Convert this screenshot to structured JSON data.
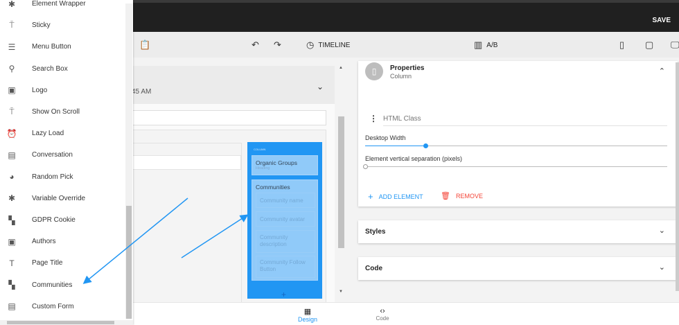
{
  "topbar": {
    "save_label": "SAVE"
  },
  "toolbar": {
    "timeline_label": "TIMELINE",
    "ab_label": "A/B"
  },
  "canvas": {
    "time_text": "45 AM",
    "column_label": "COLUMN",
    "heading_card": {
      "title": "Organic Groups",
      "subtitle": "Heading"
    },
    "communities_card": {
      "title": "Communities",
      "items": [
        "Community name",
        "Community avatar",
        "Community description",
        "Community Follow Button"
      ]
    }
  },
  "properties": {
    "title": "Properties",
    "subtitle": "Column",
    "html_class_placeholder": "HTML Class",
    "desktop_width_label": "Desktop Width",
    "desktop_width_value": 0.2,
    "vertical_sep_label": "Element vertical separation (pixels)",
    "vertical_sep_value": 0,
    "add_element_label": "ADD ELEMENT",
    "remove_label": "REMOVE"
  },
  "sections": {
    "styles": "Styles",
    "code": "Code"
  },
  "bottom": {
    "design": "Design",
    "code": "Code"
  },
  "colors": {
    "accent": "#2196f3",
    "danger": "#f44336",
    "topbar": "#202020"
  },
  "sidebar": {
    "items": [
      {
        "label": "Element Wrapper",
        "icon": "puzzle-icon"
      },
      {
        "label": "Sticky",
        "icon": "pin-top-icon"
      },
      {
        "label": "Menu Button",
        "icon": "menu-icon"
      },
      {
        "label": "Search Box",
        "icon": "search-icon"
      },
      {
        "label": "Logo",
        "icon": "image-icon"
      },
      {
        "label": "Show On Scroll",
        "icon": "pin-top-icon"
      },
      {
        "label": "Lazy Load",
        "icon": "alarm-icon"
      },
      {
        "label": "Conversation",
        "icon": "chat-icon"
      },
      {
        "label": "Random Pick",
        "icon": "pie-icon"
      },
      {
        "label": "Variable Override",
        "icon": "puzzle-icon"
      },
      {
        "label": "GDPR Cookie",
        "icon": "widgets-icon"
      },
      {
        "label": "Authors",
        "icon": "badge-icon"
      },
      {
        "label": "Page Title",
        "icon": "text-icon"
      },
      {
        "label": "Communities",
        "icon": "widgets-icon"
      },
      {
        "label": "Custom Form",
        "icon": "document-icon"
      }
    ]
  }
}
